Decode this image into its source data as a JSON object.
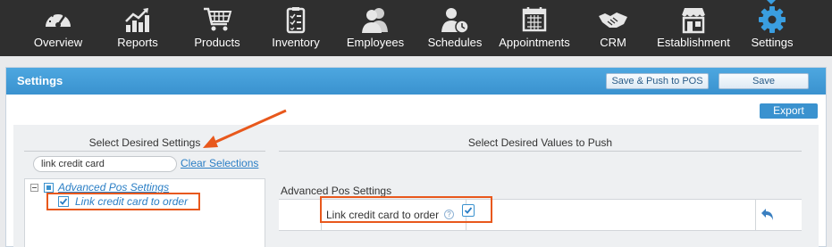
{
  "nav": {
    "items": [
      {
        "label": "Overview",
        "icon": "gauge-icon"
      },
      {
        "label": "Reports",
        "icon": "chart-icon"
      },
      {
        "label": "Products",
        "icon": "cart-icon"
      },
      {
        "label": "Inventory",
        "icon": "clipboard-icon"
      },
      {
        "label": "Employees",
        "icon": "people-icon"
      },
      {
        "label": "Schedules",
        "icon": "person-clock-icon"
      },
      {
        "label": "Appointments",
        "icon": "calendar-icon"
      },
      {
        "label": "CRM",
        "icon": "handshake-icon"
      },
      {
        "label": "Establishment",
        "icon": "storefront-icon"
      },
      {
        "label": "Settings",
        "icon": "gear-icon"
      }
    ],
    "active": "Settings"
  },
  "header": {
    "title": "Settings",
    "push_label": "Save & Push to POS",
    "save_label": "Save"
  },
  "export_label": "Export",
  "left": {
    "heading": "Select Desired Settings",
    "search_value": "link credit card",
    "clear_label": "Clear Selections",
    "tree": {
      "parent_label": "Advanced Pos Settings",
      "child_label": "Link credit card to order",
      "child_checked": true
    }
  },
  "right": {
    "heading": "Select Desired Values to Push",
    "section_label": "Advanced Pos Settings",
    "row_label": "Link credit card to order",
    "help_symbol": "?",
    "row_checked": true
  },
  "colors": {
    "nav_bg": "#2f2f2f",
    "header_blue": "#3a92cf",
    "highlight_orange": "#e8581c",
    "active_icon": "#3a9ee0"
  }
}
